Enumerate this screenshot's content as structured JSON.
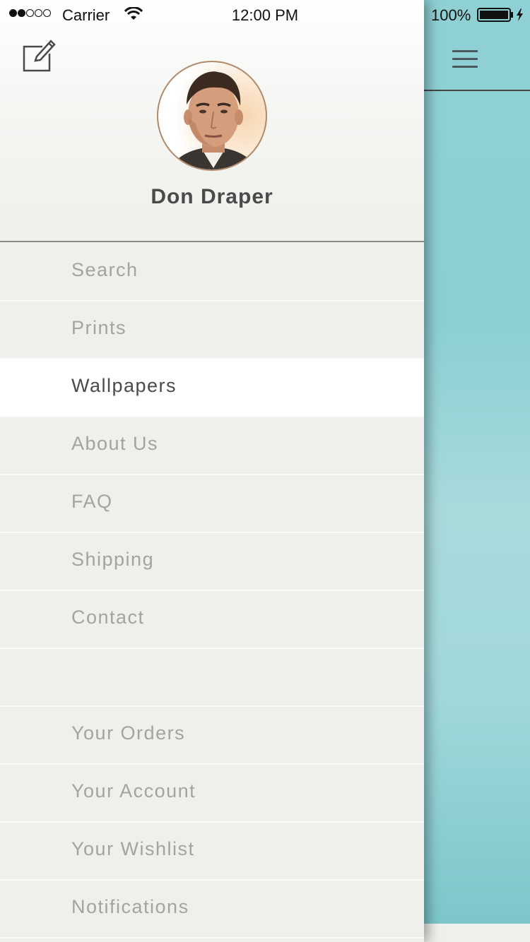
{
  "status_bar": {
    "carrier": "Carrier",
    "time": "12:00 PM",
    "battery_percent": "100%",
    "signal_strength": 2,
    "signal_max": 5
  },
  "drawer": {
    "user_name": "Don Draper",
    "edit_icon": "edit-icon",
    "menu_items": [
      {
        "label": "Search",
        "active": false
      },
      {
        "label": "Prints",
        "active": false
      },
      {
        "label": "Wallpapers",
        "active": true
      },
      {
        "label": "About Us",
        "active": false
      },
      {
        "label": "FAQ",
        "active": false
      },
      {
        "label": "Shipping",
        "active": false
      },
      {
        "label": "Contact",
        "active": false
      },
      {
        "label": "",
        "active": false
      },
      {
        "label": "Your Orders",
        "active": false
      },
      {
        "label": "Your Account",
        "active": false
      },
      {
        "label": "Your Wishlist",
        "active": false
      },
      {
        "label": "Notifications",
        "active": false
      }
    ]
  },
  "content": {
    "menu_icon": "hamburger-menu-icon"
  },
  "colors": {
    "teal": "#8fd0d4",
    "drawer_bg": "#efefeb",
    "active_bg": "#ffffff",
    "inactive_text": "#a3a3a3",
    "active_text": "#4a4a4a"
  }
}
